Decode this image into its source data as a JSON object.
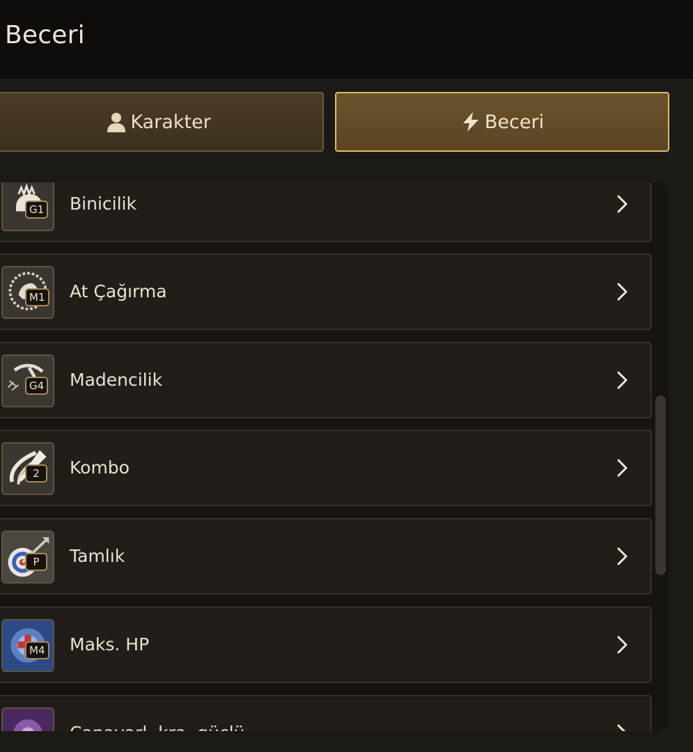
{
  "header": {
    "title": "Beceri"
  },
  "tabs": [
    {
      "label": "Karakter",
      "icon": "user-icon",
      "active": false
    },
    {
      "label": "Beceri",
      "icon": "lightning-icon",
      "active": true
    }
  ],
  "skills": [
    {
      "name": "Binicilik",
      "badge": "G1",
      "icon": "horse-riding-icon"
    },
    {
      "name": "At Çağırma",
      "badge": "M1",
      "icon": "horse-summon-icon"
    },
    {
      "name": "Madencilik",
      "badge": "G4",
      "icon": "pickaxe-icon"
    },
    {
      "name": "Kombo",
      "badge": "2",
      "icon": "combo-slash-icon"
    },
    {
      "name": "Tamlık",
      "badge": "P",
      "icon": "target-arrow-icon"
    },
    {
      "name": "Maks. HP",
      "badge": "M4",
      "icon": "max-hp-icon"
    },
    {
      "name": "Canavarl. kra. güclü",
      "badge": "",
      "icon": "monster-power-icon"
    }
  ],
  "colors": {
    "accent_border": "#e0bd67",
    "active_tab": "#6c532e",
    "row_bg": "#211e19"
  }
}
